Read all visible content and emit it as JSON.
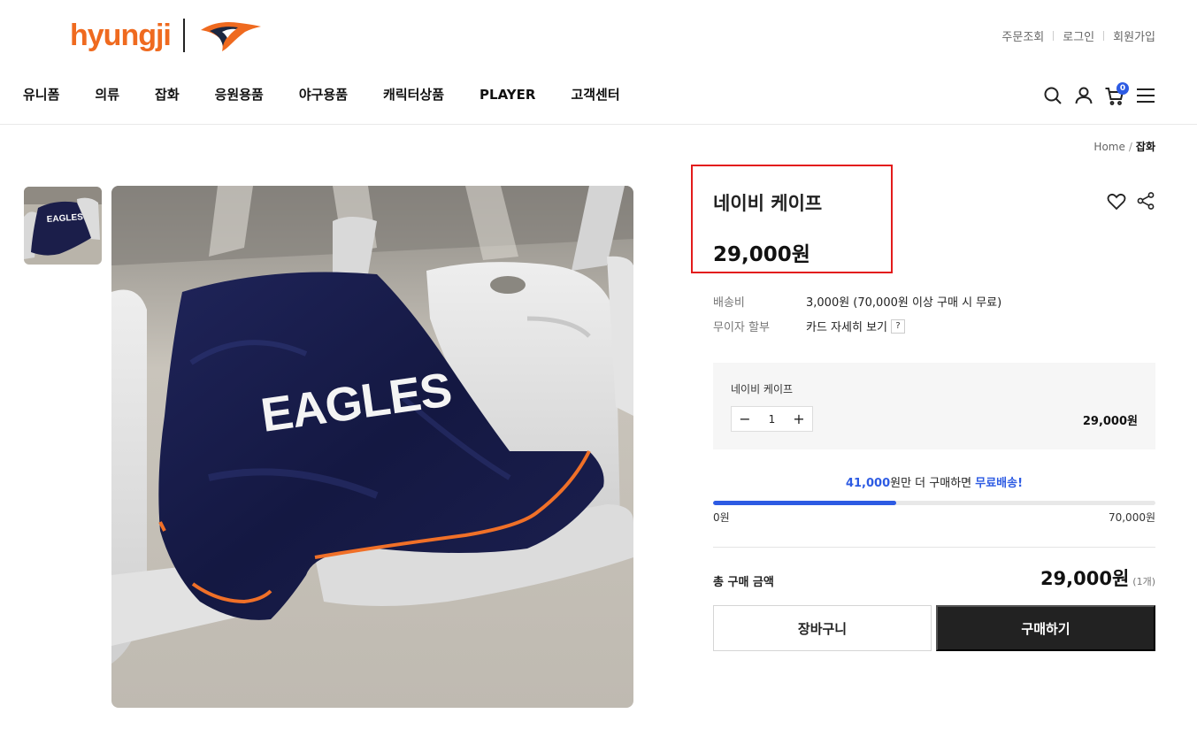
{
  "header": {
    "logo_text": "hyungji",
    "top_links": [
      "주문조회",
      "로그인",
      "회원가입"
    ],
    "nav": [
      "유니폼",
      "의류",
      "잡화",
      "응원용품",
      "야구용품",
      "캐릭터상품",
      "PLAYER",
      "고객센터"
    ],
    "icons": [
      "search-icon",
      "user-icon",
      "cart-icon",
      "menu-icon"
    ],
    "cart_count": "0"
  },
  "breadcrumb": {
    "home": "Home",
    "separator": "/",
    "current": "잡화"
  },
  "gallery": {
    "photo_text": "EAGLES"
  },
  "product": {
    "name": "네이비 케이프",
    "price": "29,000원",
    "shipping_label": "배송비",
    "shipping_value": "3,000원 (70,000원 이상 구매 시 무료)",
    "installment_label": "무이자 할부",
    "installment_value": "카드 자세히 보기",
    "installment_help": "?"
  },
  "option": {
    "name": "네이비 케이프",
    "minus": "−",
    "quantity": "1",
    "plus": "+",
    "price": "29,000원"
  },
  "free_shipping": {
    "remaining": "41,000",
    "mid_text": "원만 더 구매하면 ",
    "highlight": "무료배송!",
    "progress_fraction": 0.414,
    "min_label": "0원",
    "max_label": "70,000원"
  },
  "total": {
    "label": "총 구매 금액",
    "amount": "29,000원",
    "count": "(1개)"
  },
  "buttons": {
    "cart": "장바구니",
    "buy": "구매하기"
  },
  "colors": {
    "brand_orange": "#ef6a1f",
    "accent_blue": "#2d5be3",
    "highlight_red": "#e31b1b",
    "buy_button": "#222222"
  }
}
